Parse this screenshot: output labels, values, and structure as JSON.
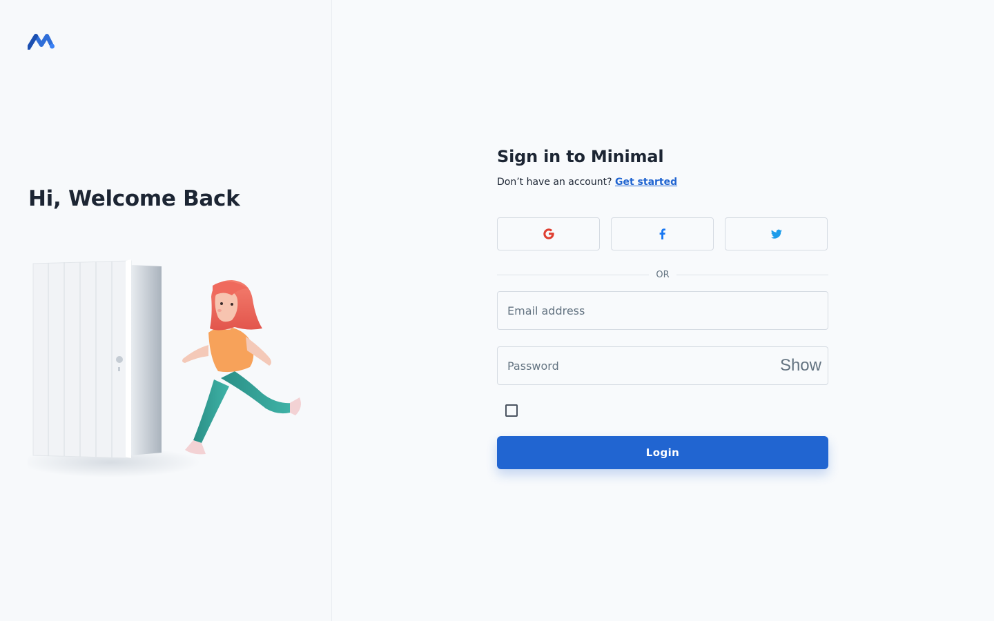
{
  "brand": {
    "logo_icon": "minimal-logo-icon",
    "accent": "#2165d1"
  },
  "left": {
    "heading": "Hi, Welcome Back",
    "illustration": "girl-running-out-door-illustration"
  },
  "form": {
    "title": "Sign in to Minimal",
    "subtitle_text": "Don’t have an account?",
    "get_started": "Get started",
    "social": [
      {
        "icon": "google-icon"
      },
      {
        "icon": "facebook-icon"
      },
      {
        "icon": "twitter-icon"
      }
    ],
    "divider_text": "OR",
    "email_placeholder": "Email address",
    "password_placeholder": "Password",
    "show_label": "Show",
    "remember_checked": false,
    "login_label": "Login"
  }
}
